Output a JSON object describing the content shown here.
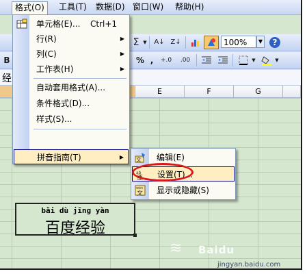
{
  "menubar": {
    "items": [
      {
        "label": "格式(O)",
        "active": true
      },
      {
        "label": "工具(T)",
        "active": false
      },
      {
        "label": "数据(D)",
        "active": false
      },
      {
        "label": "窗口(W)",
        "active": false
      },
      {
        "label": "帮助(H)",
        "active": false
      }
    ]
  },
  "toolbar1": {
    "sigma": "Σ",
    "sort_asc": "A↓",
    "sort_desc": "Z↓",
    "zoom_value": "100%",
    "help": "?"
  },
  "toolbar2": {
    "bold": "B",
    "percent": "%",
    "comma": ",",
    "inc_decimal": "+.0",
    "dec_decimal": ".00"
  },
  "formula_strip": {
    "visible_text": "经"
  },
  "columns": [
    "E",
    "F",
    "G"
  ],
  "format_menu": {
    "items": [
      {
        "label": "单元格(E)...",
        "shortcut": "Ctrl+1",
        "submenu": false,
        "icon": "cells-icon"
      },
      {
        "label": "行(R)",
        "submenu": true
      },
      {
        "label": "列(C)",
        "submenu": true
      },
      {
        "label": "工作表(H)",
        "submenu": true
      },
      {
        "label": "自动套用格式(A)...",
        "submenu": false
      },
      {
        "label": "条件格式(D)...",
        "submenu": false
      },
      {
        "label": "样式(S)...",
        "submenu": false
      },
      {
        "label": "拼音指南(T)",
        "submenu": true,
        "highlighted": true
      }
    ]
  },
  "pinyin_submenu": {
    "items": [
      {
        "label": "编辑(E)",
        "icon": "edit-phonetic-icon"
      },
      {
        "label": "设置(T)...",
        "icon": "phonetic-settings-icon",
        "highlighted": true
      },
      {
        "label": "显示或隐藏(S)",
        "icon": "show-hide-phonetic-icon"
      }
    ]
  },
  "cell": {
    "pinyin": "bǎi dù jīng yàn",
    "text": "百度经验"
  },
  "watermark": {
    "brand": "Baidu",
    "url": "jingyan.baidu.com"
  },
  "colors": {
    "sheet_bg": "#d6e7cf",
    "menu_highlight": "#ffeec2",
    "annotation_red": "#d8181a"
  }
}
